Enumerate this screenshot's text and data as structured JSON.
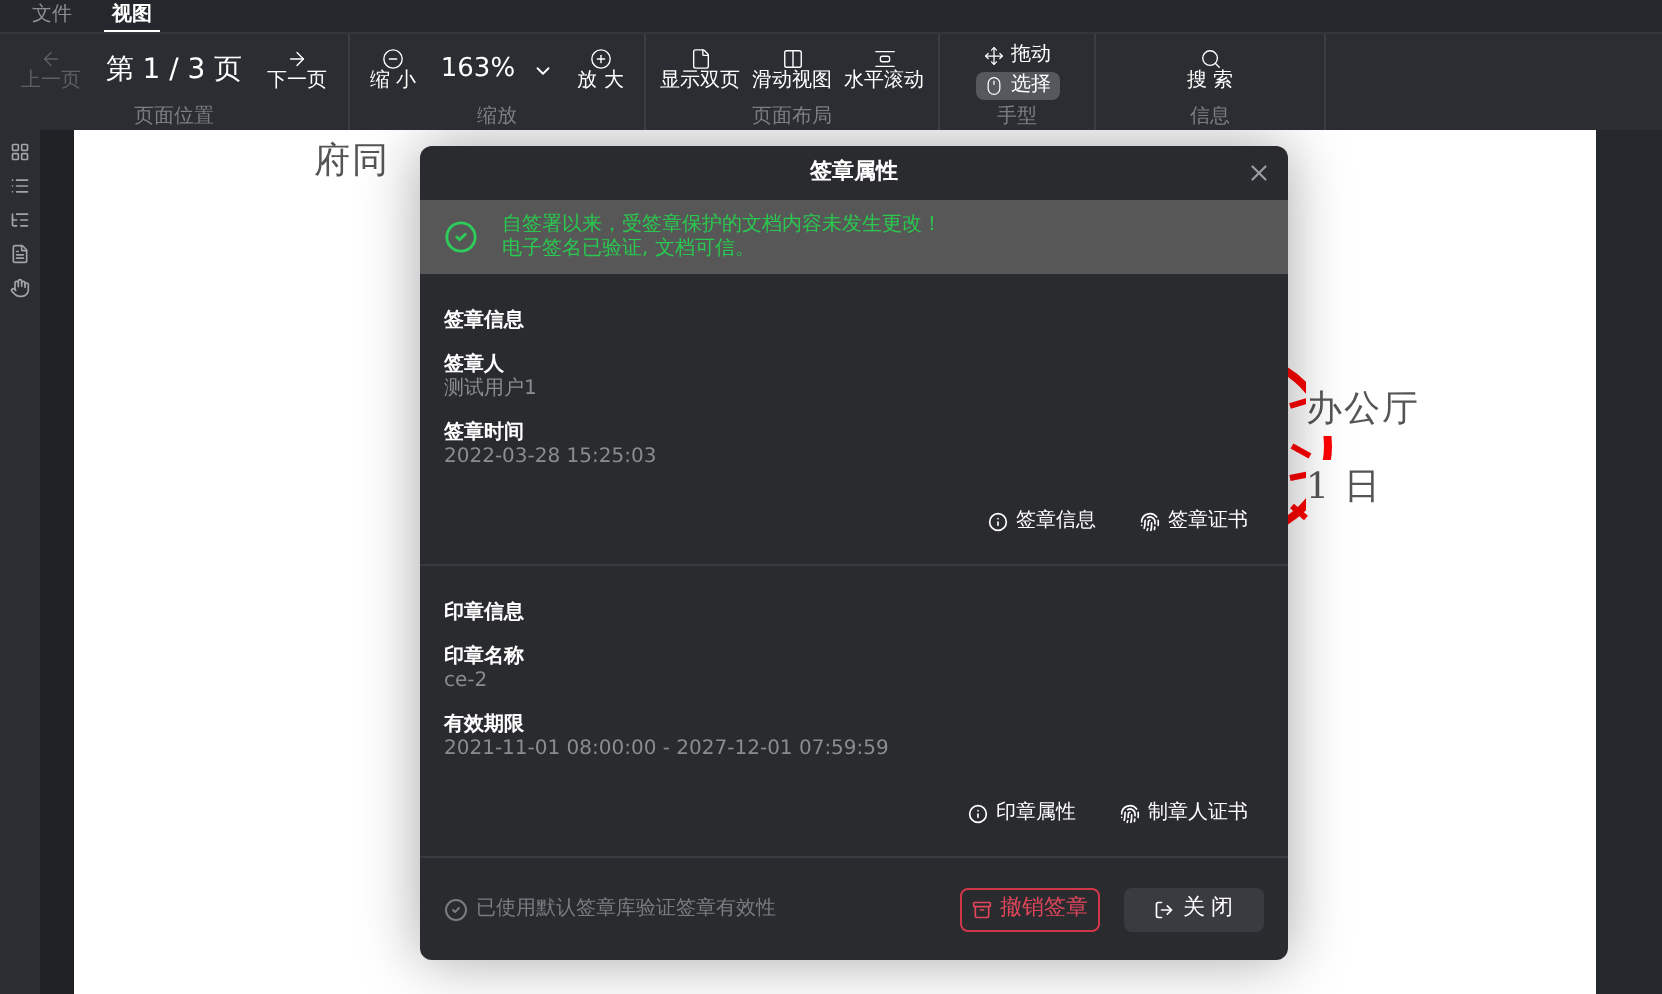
{
  "menu_tabs": [
    {
      "label": "文件",
      "selected": false
    },
    {
      "label": "视图",
      "selected": true
    }
  ],
  "toolbar": {
    "groups": [
      {
        "label": "页面位置",
        "items": [
          {
            "kind": "button",
            "label": "上一页",
            "disabled": true
          },
          {
            "kind": "page",
            "label": "第 1 / 3 页"
          },
          {
            "kind": "button",
            "label": "下一页",
            "disabled": false
          }
        ]
      },
      {
        "label": "缩放",
        "items": [
          {
            "kind": "button",
            "label": "缩 小",
            "disabled": false
          },
          {
            "kind": "zoom",
            "label": "163%"
          },
          {
            "kind": "button",
            "label": "放 大",
            "disabled": false
          }
        ]
      },
      {
        "label": "页面布局",
        "items": [
          {
            "kind": "button",
            "label": "显示双页",
            "disabled": false
          },
          {
            "kind": "button",
            "label": "滑动视图",
            "disabled": false
          },
          {
            "kind": "button",
            "label": "水平滚动",
            "disabled": false
          }
        ]
      },
      {
        "label": "手型",
        "items": [
          {
            "kind": "modes",
            "options": [
              {
                "label": "拖动",
                "selected": false
              },
              {
                "label": "选择",
                "selected": true
              }
            ]
          }
        ]
      },
      {
        "label": "信息",
        "items": [
          {
            "kind": "button",
            "label": "搜 索",
            "disabled": false
          }
        ]
      }
    ]
  },
  "document": {
    "lines": [
      "府同",
      "办公厅",
      "1 日"
    ]
  },
  "dialog": {
    "title": "签章属性",
    "banner": {
      "title": "自签署以来，受签章保护的文档内容未发生更改！",
      "subtitle": "电子签名已验证, 文档可信。"
    },
    "sections": [
      {
        "heading": "签章信息",
        "fields": [
          {
            "label": "签章人",
            "value": "测试用户1"
          },
          {
            "label": "签章时间",
            "value": "2022-03-28 15:25:03"
          }
        ],
        "actions": [
          {
            "label": "签章信息"
          },
          {
            "label": "签章证书"
          }
        ]
      },
      {
        "heading": "印章信息",
        "fields": [
          {
            "label": "印章名称",
            "value": "ce-2"
          },
          {
            "label": "有效期限",
            "value": "2021-11-01 08:00:00 - 2027-12-01 07:59:59"
          }
        ],
        "actions": [
          {
            "label": "印章属性"
          },
          {
            "label": "制章人证书"
          }
        ]
      }
    ],
    "footer": {
      "note": "已使用默认签章库验证签章有效性",
      "buttons": [
        {
          "label": "撤销签章",
          "kind": "danger"
        },
        {
          "label": "关 闭",
          "kind": "default"
        }
      ]
    }
  }
}
